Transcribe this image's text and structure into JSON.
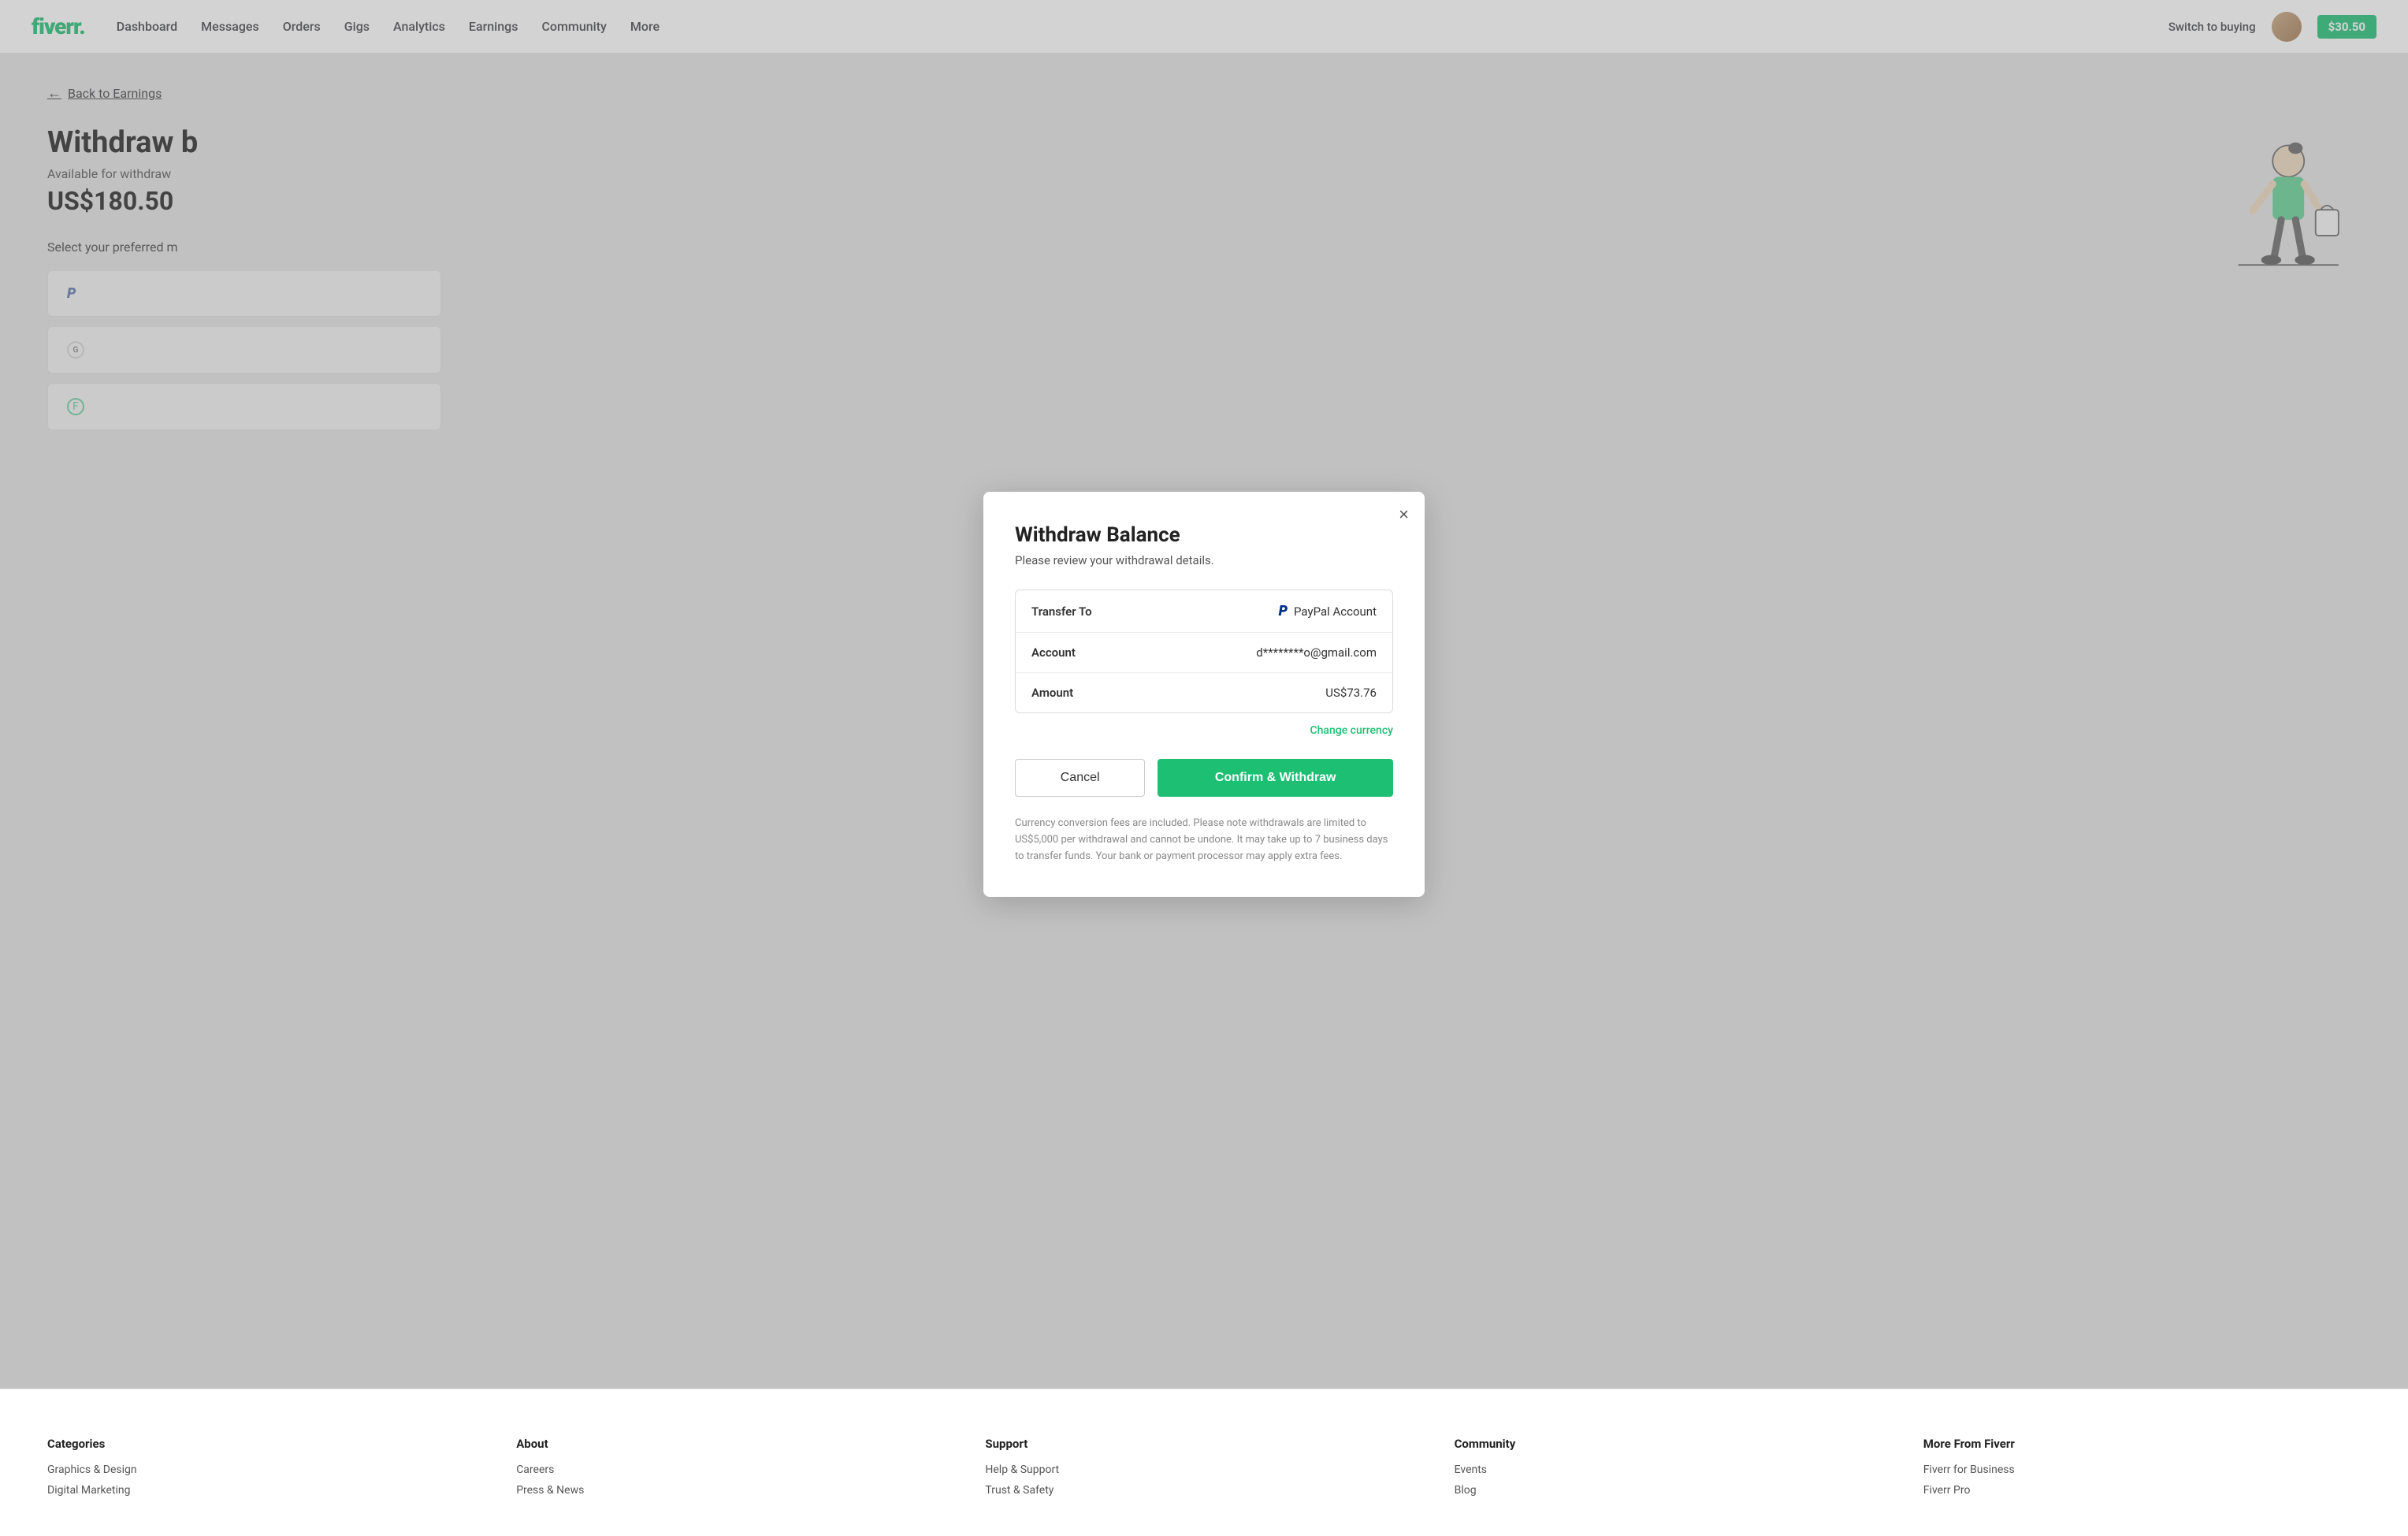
{
  "navbar": {
    "logo": "fiverr",
    "logo_dot": ".",
    "nav_items": [
      "Dashboard",
      "Messages",
      "Orders",
      "Gigs",
      "Analytics",
      "Earnings",
      "Community",
      "More"
    ],
    "switch_buying": "Switch to buying",
    "balance": "$30.50"
  },
  "page": {
    "back_link": "Back to Earnings",
    "title": "Withdraw b",
    "available_label": "Available for withdraw",
    "amount": "US$180.50",
    "preferred_label": "Select your preferred m"
  },
  "modal": {
    "title": "Withdraw Balance",
    "subtitle": "Please review your withdrawal details.",
    "close_label": "×",
    "rows": [
      {
        "label": "Transfer To",
        "value": "PayPal Account",
        "icon": "paypal"
      },
      {
        "label": "Account",
        "value": "d********o@gmail.com",
        "icon": ""
      },
      {
        "label": "Amount",
        "value": "US$73.76",
        "icon": ""
      }
    ],
    "change_currency": "Change currency",
    "cancel_label": "Cancel",
    "confirm_label": "Confirm & Withdraw",
    "disclaimer": "Currency conversion fees are included. Please note withdrawals are limited to US$5,000 per withdrawal and cannot be undone. It may take up to 7 business days to transfer funds. Your bank or payment processor may apply extra fees."
  },
  "footer": {
    "columns": [
      {
        "title": "Categories",
        "links": [
          "Graphics & Design",
          "Digital Marketing"
        ]
      },
      {
        "title": "About",
        "links": [
          "Careers",
          "Press & News"
        ]
      },
      {
        "title": "Support",
        "links": [
          "Help & Support",
          "Trust & Safety"
        ]
      },
      {
        "title": "Community",
        "links": [
          "Events",
          "Blog"
        ]
      },
      {
        "title": "More From Fiverr",
        "links": [
          "Fiverr for Business",
          "Fiverr Pro"
        ]
      }
    ]
  }
}
